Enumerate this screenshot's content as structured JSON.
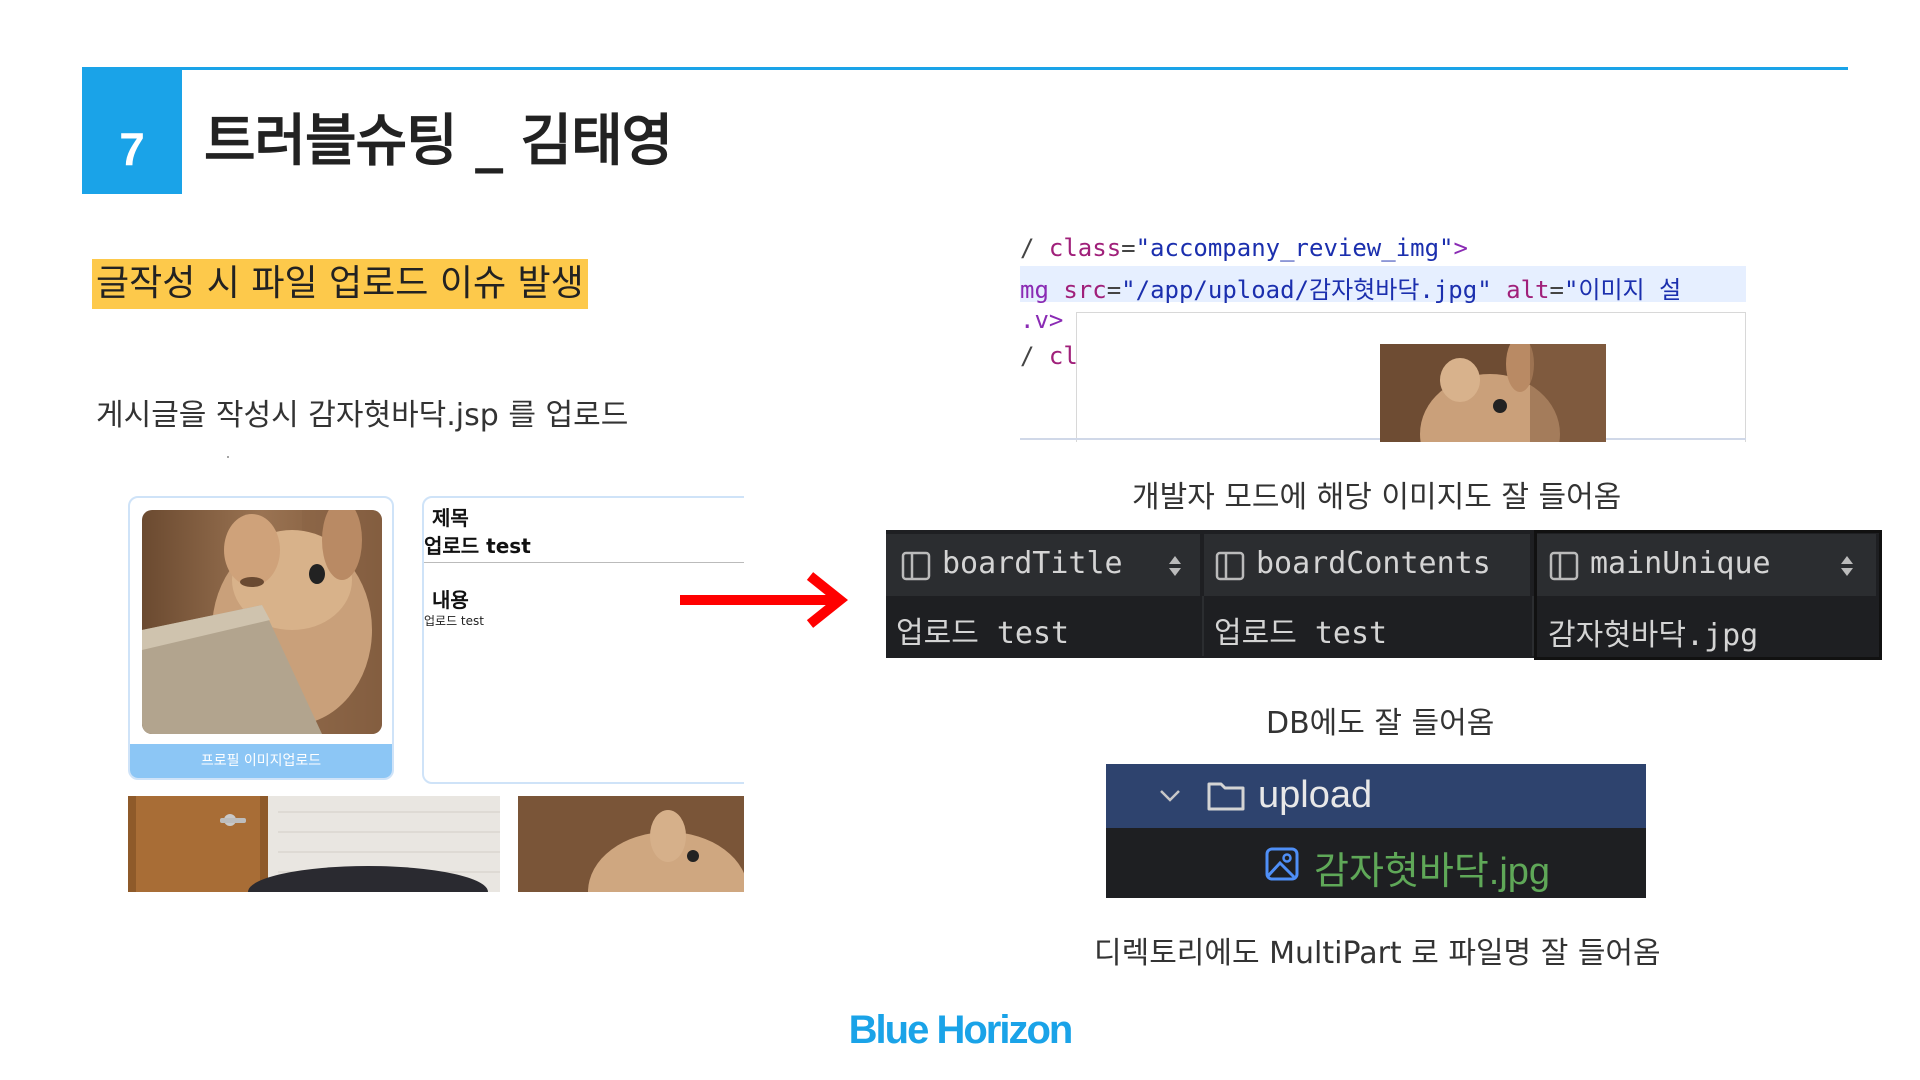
{
  "slide": {
    "number": "7",
    "title": "트러블슈팅 _ 김태영",
    "highlight": "글작성 시 파일 업로드 이슈 발생",
    "description": "게시글을 작성시 감자혓바닥.jsp 를 업로드",
    "accent_color": "#1aa3e8",
    "highlight_color": "#fdc94b"
  },
  "left_screenshot": {
    "profile_button": "프로필 이미지업로드",
    "title_label": "제목",
    "title_value": "업로드 test",
    "content_label": "내용",
    "content_value": "업로드 test"
  },
  "devtools": {
    "line1_prefix": "/ ",
    "line1_attr": "class",
    "line1_value": "\"accompany_review_img\"",
    "line1_close": ">",
    "line2_prefix": "mg ",
    "line2_attr": "src",
    "line2_value": "\"/app/upload/감자혓바닥.jpg\"",
    "line2_attr2": "alt",
    "line2_value2": "\"이미지 설",
    "line3": ".v>",
    "line4_prefix": "/ ",
    "line4_attr": "cl"
  },
  "captions": {
    "devtools": "개발자 모드에 해당 이미지도 잘 들어옴",
    "db": "DB에도 잘 들어옴",
    "directory": "디렉토리에도 MultiPart 로 파일명 잘 들어옴"
  },
  "db_table": {
    "columns": [
      "boardTitle",
      "boardContents",
      "mainUnique"
    ],
    "row": [
      "업로드 test",
      "업로드 test",
      "감자혓바닥.jpg"
    ]
  },
  "directory": {
    "folder": "upload",
    "file": "감자혓바닥.jpg"
  },
  "footer": {
    "brand": "Blue Horizon"
  }
}
